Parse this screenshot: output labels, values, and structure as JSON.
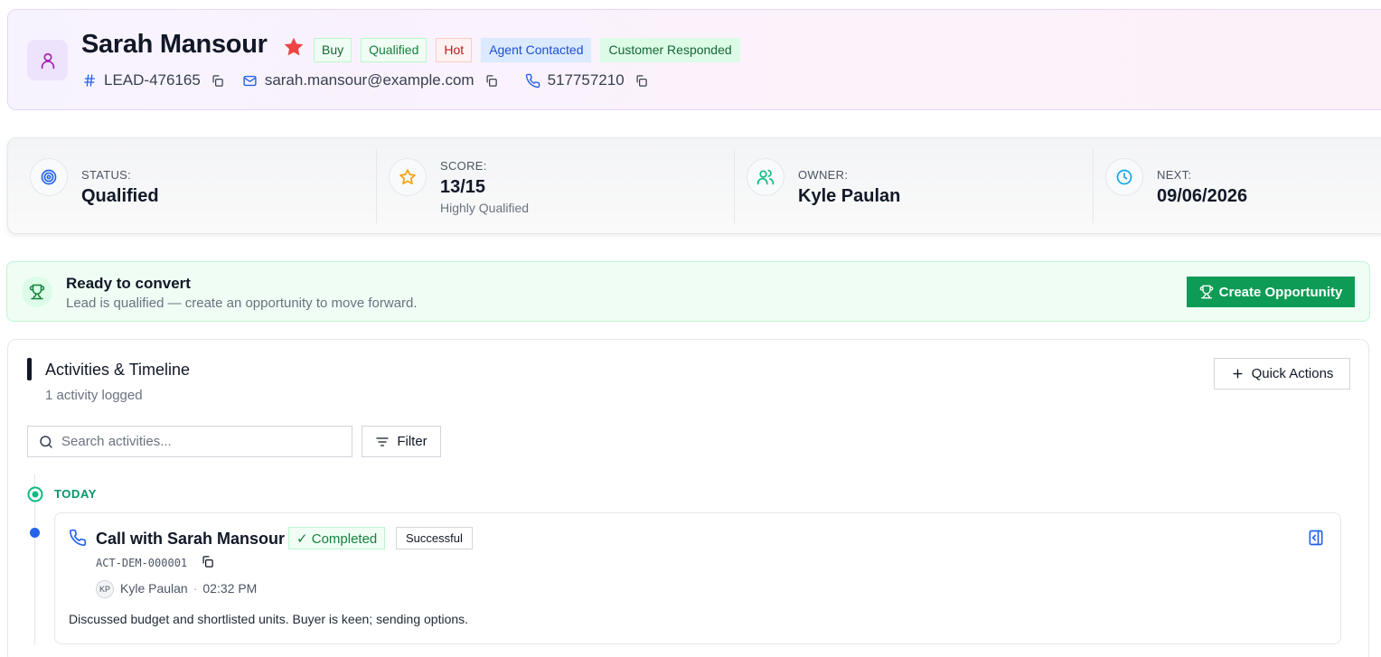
{
  "lead": {
    "name": "Sarah Mansour",
    "tags": [
      "Buy",
      "Qualified",
      "Hot",
      "Agent Contacted",
      "Customer Responded"
    ],
    "id": "LEAD-476165",
    "email": "sarah.mansour@example.com",
    "phone": "517757210"
  },
  "stats": {
    "status_label": "STATUS:",
    "status_value": "Qualified",
    "score_label": "SCORE:",
    "score_value": "13/15",
    "score_sub": "Highly Qualified",
    "owner_label": "OWNER:",
    "owner_value": "Kyle Paulan",
    "next_label": "NEXT:",
    "next_value": "09/06/2026"
  },
  "convert": {
    "title": "Ready to convert",
    "subtitle": "Lead is qualified — create an opportunity to move forward.",
    "button_label": "Create Opportunity"
  },
  "activities": {
    "title": "Activities & Timeline",
    "count_text": "1 activity logged",
    "quick_actions_label": "Quick Actions",
    "search_placeholder": "Search activities...",
    "filter_label": "Filter",
    "group_label": "TODAY",
    "items": [
      {
        "title": "Call with Sarah Mansour",
        "status": "✓ Completed",
        "outcome": "Successful",
        "id": "ACT-DEM-000001",
        "initials": "KP",
        "user": "Kyle Paulan",
        "separator": "·",
        "time": "02:32 PM",
        "description": "Discussed budget and shortlisted units. Buyer is keen; sending options."
      }
    ]
  },
  "colors": {
    "accent_green": "#0d9b55",
    "star_red": "#ef4444",
    "timeline_dot_blue": "#2563eb",
    "today_green": "#059669"
  },
  "icons": {
    "lead_avatar": "user-icon",
    "favorite": "star-icon",
    "id": "hash-icon",
    "email": "mail-icon",
    "phone": "phone-icon",
    "status": "target-icon",
    "score": "star-outline-icon",
    "owner": "users-icon",
    "next": "clock-icon",
    "convert": "trophy-icon",
    "quick_actions": "plus-icon",
    "search": "search-icon",
    "filter": "filter-icon",
    "panel": "panel-icon"
  }
}
